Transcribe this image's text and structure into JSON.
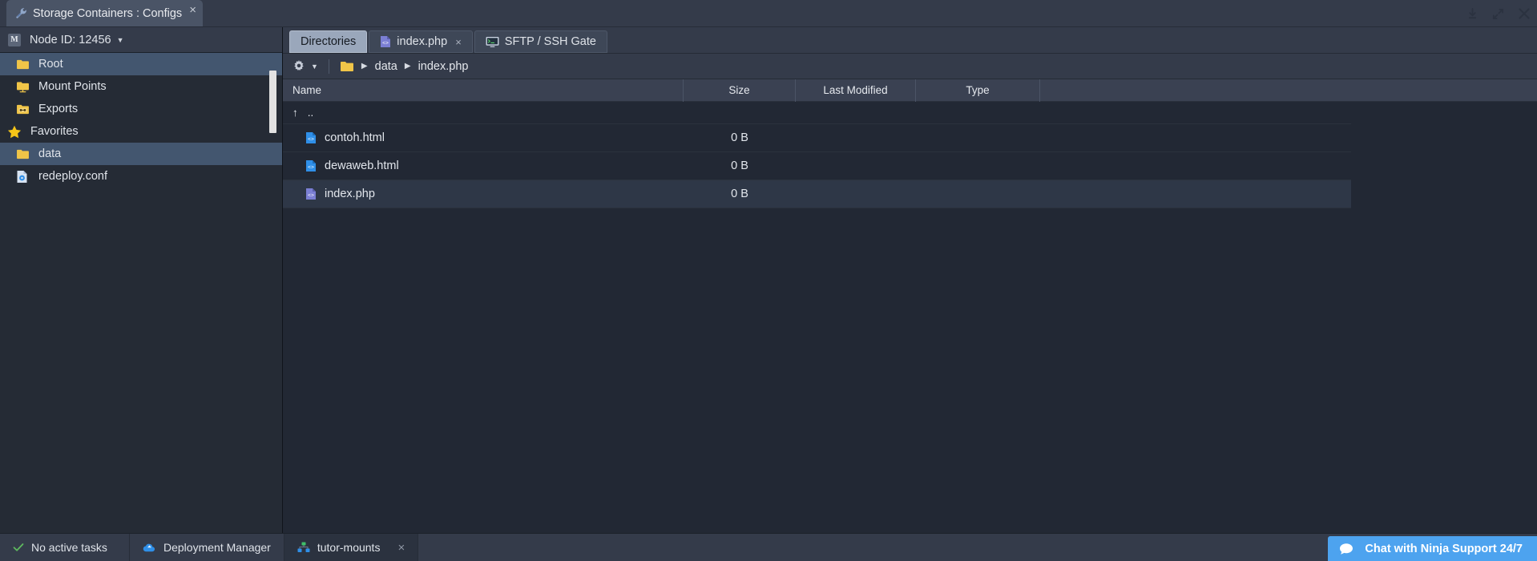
{
  "window": {
    "app_tab_title": "Storage Containers : Configs",
    "app_tab_icon": "wrench-icon",
    "app_tab_close": "×",
    "controls": [
      {
        "name": "download-icon",
        "label": "download"
      },
      {
        "name": "expand-icon",
        "label": "expand"
      },
      {
        "name": "close-icon",
        "label": "close"
      }
    ]
  },
  "sidebar": {
    "node_badge": "M",
    "node_label": "Node ID: 12456",
    "node_caret": "▼",
    "items": [
      {
        "label": "Root",
        "icon": "folder-icon",
        "selected": true,
        "group": false
      },
      {
        "label": "Mount Points",
        "icon": "folder-mount-icon",
        "selected": false,
        "group": false
      },
      {
        "label": "Exports",
        "icon": "folder-exports-icon",
        "selected": false,
        "group": false
      },
      {
        "label": "Favorites",
        "icon": "star-icon",
        "selected": false,
        "group": true
      },
      {
        "label": "data",
        "icon": "folder-icon",
        "selected": true,
        "group": false
      },
      {
        "label": "redeploy.conf",
        "icon": "conf-file-icon",
        "selected": false,
        "group": false
      }
    ]
  },
  "main": {
    "tabs": [
      {
        "label": "Directories",
        "icon": "",
        "active": true,
        "closable": false
      },
      {
        "label": "index.php",
        "icon": "php-file-icon",
        "active": false,
        "closable": true
      },
      {
        "label": "SFTP / SSH Gate",
        "icon": "terminal-icon",
        "active": false,
        "closable": false
      }
    ],
    "tab_close_glyph": "×",
    "breadcrumb": {
      "gear_icon": "gear-icon",
      "gear_caret": "▼",
      "folder_icon": "folder-icon",
      "arrow": "▶",
      "segments": [
        "data",
        "index.php"
      ]
    },
    "columns": [
      "Name",
      "Size",
      "Last Modified",
      "Type"
    ],
    "up_dir": {
      "glyph": "↑",
      "label": ".."
    },
    "rows": [
      {
        "name": "contoh.html",
        "icon": "html-file-icon",
        "size": "0 B",
        "modified": "",
        "type": "",
        "selected": false
      },
      {
        "name": "dewaweb.html",
        "icon": "html-file-icon",
        "size": "0 B",
        "modified": "",
        "type": "",
        "selected": false
      },
      {
        "name": "index.php",
        "icon": "php-file-icon",
        "size": "0 B",
        "modified": "",
        "type": "",
        "selected": true
      }
    ]
  },
  "statusbar": {
    "tasks": {
      "icon": "check-icon",
      "label": "No active tasks"
    },
    "deployment": {
      "icon": "cloud-icon",
      "label": "Deployment Manager"
    },
    "session": {
      "icon": "network-icon",
      "label": "tutor-mounts",
      "close": "×"
    },
    "chat": {
      "icon": "chat-bubble-icon",
      "label": "Chat with Ninja Support 24/7"
    }
  },
  "colors": {
    "accent_blue": "#4da3ef",
    "selection": "#43566f",
    "row_selection": "#2e3747",
    "folder_yellow": "#f0c548",
    "html_blue": "#2f8fe8",
    "php_purple": "#7b7fd4",
    "ok_green": "#5eb85e"
  }
}
